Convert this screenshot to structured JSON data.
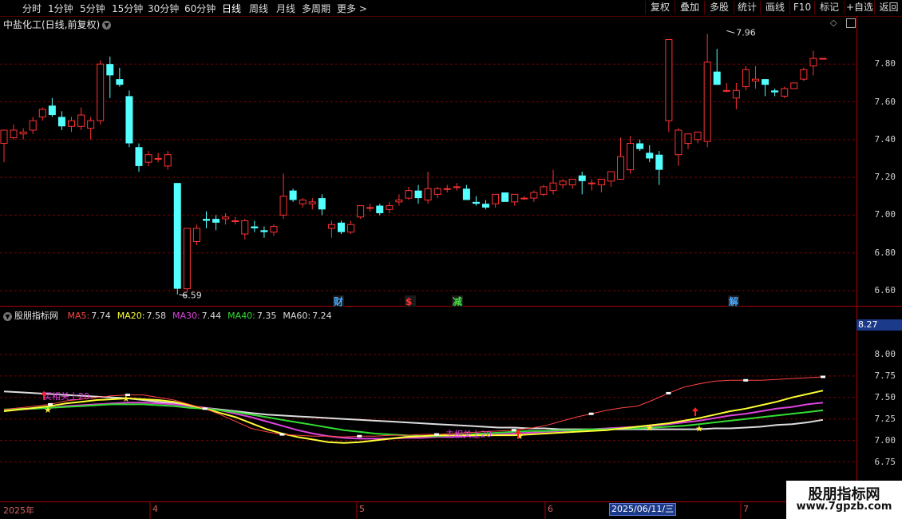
{
  "toolbar": {
    "timeframes": [
      "分时",
      "1分钟",
      "5分钟",
      "15分钟",
      "30分钟",
      "60分钟",
      "日线",
      "周线",
      "月线",
      "多周期",
      "更多 >"
    ],
    "active": "日线",
    "right_buttons": [
      "复权",
      "叠加",
      "多股",
      "统计",
      "画线",
      "F10",
      "标记",
      "+自选",
      "返回"
    ]
  },
  "chart_title": "中盐化工(日线,前复权)",
  "price_panel": {
    "y_ticks": [
      "7.80",
      "7.60",
      "7.40",
      "7.20",
      "7.00",
      "6.80",
      "6.60"
    ],
    "low_label": "6.59",
    "high_label": "7.96",
    "event_tags": [
      {
        "text": "财",
        "color": "#4aa8ff"
      },
      {
        "text": "$",
        "color": "#ff3333"
      },
      {
        "text": "减",
        "color": "#44dd44"
      },
      {
        "text": "解",
        "color": "#4aa8ff"
      }
    ]
  },
  "indicator": {
    "name": "股朋指标网",
    "ma": [
      {
        "label": "MA5:",
        "value": "7.74",
        "color": "#ff4444"
      },
      {
        "label": "MA20:",
        "value": "7.58",
        "color": "#ffff33"
      },
      {
        "label": "MA30:",
        "value": "7.44",
        "color": "#dd44dd"
      },
      {
        "label": "MA40:",
        "value": "7.35",
        "color": "#33dd33"
      },
      {
        "label": "MA60:",
        "value": "7.24",
        "color": "#dddddd"
      }
    ],
    "current_value": "8.27",
    "y_ticks": [
      "8.00",
      "7.75",
      "7.50",
      "7.25",
      "7.00",
      "6.75"
    ],
    "annotations": [
      "买相关上20",
      "主相关上20"
    ]
  },
  "x_axis": {
    "labels": [
      "2025年",
      "4",
      "5",
      "6",
      "7"
    ],
    "cursor_date": "2025/06/11/三"
  },
  "candles": [
    [
      7.38,
      7.45,
      7.28,
      7.45
    ],
    [
      7.41,
      7.48,
      7.4,
      7.45
    ],
    [
      7.43,
      7.46,
      7.4,
      7.44
    ],
    [
      7.45,
      7.52,
      7.43,
      7.5
    ],
    [
      7.52,
      7.57,
      7.5,
      7.56
    ],
    [
      7.58,
      7.62,
      7.52,
      7.53
    ],
    [
      7.52,
      7.55,
      7.45,
      7.47
    ],
    [
      7.47,
      7.52,
      7.44,
      7.5
    ],
    [
      7.47,
      7.57,
      7.45,
      7.53
    ],
    [
      7.46,
      7.52,
      7.4,
      7.5
    ],
    [
      7.5,
      7.82,
      7.48,
      7.8
    ],
    [
      7.8,
      7.84,
      7.62,
      7.74
    ],
    [
      7.72,
      7.78,
      7.68,
      7.69
    ],
    [
      7.63,
      7.66,
      7.36,
      7.38
    ],
    [
      7.36,
      7.38,
      7.23,
      7.26
    ],
    [
      7.28,
      7.34,
      7.26,
      7.32
    ],
    [
      7.3,
      7.33,
      7.28,
      7.3
    ],
    [
      7.26,
      7.34,
      7.24,
      7.32
    ],
    [
      7.17,
      7.17,
      6.58,
      6.61
    ],
    [
      6.61,
      6.93,
      6.59,
      6.93
    ],
    [
      6.86,
      6.95,
      6.84,
      6.93
    ],
    [
      6.98,
      7.02,
      6.93,
      6.97
    ],
    [
      6.98,
      7.0,
      6.92,
      6.96
    ],
    [
      6.98,
      7.01,
      6.95,
      6.99
    ],
    [
      6.97,
      6.99,
      6.95,
      6.97
    ],
    [
      6.9,
      6.98,
      6.87,
      6.97
    ],
    [
      6.94,
      6.97,
      6.91,
      6.93
    ],
    [
      6.92,
      6.94,
      6.88,
      6.91
    ],
    [
      6.91,
      6.95,
      6.89,
      6.94
    ],
    [
      7.0,
      7.22,
      6.98,
      7.1
    ],
    [
      7.13,
      7.14,
      7.07,
      7.08
    ],
    [
      7.06,
      7.09,
      7.04,
      7.08
    ],
    [
      7.06,
      7.09,
      7.03,
      7.07
    ],
    [
      7.09,
      7.11,
      7.0,
      7.03
    ],
    [
      6.93,
      6.97,
      6.88,
      6.95
    ],
    [
      6.96,
      6.97,
      6.9,
      6.91
    ],
    [
      6.91,
      6.97,
      6.9,
      6.95
    ],
    [
      6.99,
      7.05,
      6.98,
      7.05
    ],
    [
      7.04,
      7.06,
      7.02,
      7.04
    ],
    [
      7.05,
      7.06,
      7.0,
      7.01
    ],
    [
      7.03,
      7.07,
      7.01,
      7.05
    ],
    [
      7.07,
      7.11,
      7.05,
      7.08
    ],
    [
      7.09,
      7.15,
      7.08,
      7.13
    ],
    [
      7.13,
      7.16,
      7.06,
      7.09
    ],
    [
      7.08,
      7.23,
      7.06,
      7.14
    ],
    [
      7.11,
      7.15,
      7.09,
      7.14
    ],
    [
      7.14,
      7.16,
      7.12,
      7.14
    ],
    [
      7.15,
      7.17,
      7.13,
      7.15
    ],
    [
      7.14,
      7.16,
      7.09,
      7.08
    ],
    [
      7.07,
      7.1,
      7.05,
      7.06
    ],
    [
      7.06,
      7.08,
      7.03,
      7.04
    ],
    [
      7.06,
      7.09,
      7.04,
      7.11
    ],
    [
      7.12,
      7.12,
      7.08,
      7.07
    ],
    [
      7.07,
      7.11,
      7.05,
      7.11
    ],
    [
      7.09,
      7.1,
      7.08,
      7.09
    ],
    [
      7.09,
      7.13,
      7.07,
      7.12
    ],
    [
      7.11,
      7.16,
      7.1,
      7.15
    ],
    [
      7.13,
      7.24,
      7.11,
      7.17
    ],
    [
      7.16,
      7.19,
      7.14,
      7.18
    ],
    [
      7.16,
      7.19,
      7.14,
      7.19
    ],
    [
      7.21,
      7.23,
      7.11,
      7.18
    ],
    [
      7.17,
      7.19,
      7.13,
      7.17
    ],
    [
      7.16,
      7.19,
      7.12,
      7.19
    ],
    [
      7.18,
      7.2,
      7.15,
      7.23
    ],
    [
      7.19,
      7.41,
      7.19,
      7.31
    ],
    [
      7.24,
      7.42,
      7.22,
      7.38
    ],
    [
      7.38,
      7.4,
      7.34,
      7.35
    ],
    [
      7.33,
      7.37,
      7.28,
      7.3
    ],
    [
      7.32,
      7.34,
      7.16,
      7.24
    ],
    [
      7.5,
      7.93,
      7.44,
      7.93
    ],
    [
      7.32,
      7.46,
      7.26,
      7.45
    ],
    [
      7.38,
      7.43,
      7.35,
      7.43
    ],
    [
      7.4,
      7.44,
      7.38,
      7.44
    ],
    [
      7.39,
      7.96,
      7.36,
      7.81
    ],
    [
      7.76,
      7.88,
      7.69,
      7.69
    ],
    [
      7.66,
      7.7,
      7.65,
      7.66
    ],
    [
      7.62,
      7.7,
      7.56,
      7.66
    ],
    [
      7.68,
      7.79,
      7.66,
      7.77
    ],
    [
      7.71,
      7.79,
      7.67,
      7.72
    ],
    [
      7.72,
      7.72,
      7.63,
      7.69
    ],
    [
      7.66,
      7.67,
      7.63,
      7.65
    ],
    [
      7.63,
      7.68,
      7.62,
      7.67
    ],
    [
      7.67,
      7.7,
      7.67,
      7.7
    ],
    [
      7.72,
      7.78,
      7.71,
      7.77
    ],
    [
      7.79,
      7.87,
      7.74,
      7.83
    ],
    [
      7.83,
      7.83,
      7.83,
      7.83
    ]
  ],
  "ma_series": {
    "MA5": [
      7.36,
      7.38,
      7.4,
      7.42,
      7.46,
      7.48,
      7.5,
      7.52,
      7.53,
      7.53,
      7.5,
      7.47,
      7.42,
      7.37,
      7.3,
      7.22,
      7.14,
      7.1,
      7.07,
      7.06,
      7.05,
      7.05,
      7.04,
      7.05,
      7.05,
      7.06,
      7.06,
      7.07,
      7.07,
      7.08,
      7.09,
      7.1,
      7.11,
      7.12,
      7.14,
      7.17,
      7.22,
      7.27,
      7.31,
      7.35,
      7.38,
      7.4,
      7.47,
      7.55,
      7.62,
      7.66,
      7.69,
      7.7,
      7.7,
      7.7,
      7.71,
      7.72,
      7.73,
      7.74
    ],
    "MA20": [
      7.34,
      7.36,
      7.38,
      7.4,
      7.43,
      7.45,
      7.47,
      7.48,
      7.49,
      7.48,
      7.47,
      7.45,
      7.41,
      7.37,
      7.32,
      7.27,
      7.2,
      7.13,
      7.08,
      7.04,
      7.01,
      6.98,
      6.97,
      6.98,
      7.0,
      7.02,
      7.04,
      7.05,
      7.06,
      7.06,
      7.06,
      7.06,
      7.06,
      7.06,
      7.07,
      7.08,
      7.09,
      7.1,
      7.11,
      7.12,
      7.14,
      7.16,
      7.18,
      7.2,
      7.23,
      7.26,
      7.3,
      7.34,
      7.37,
      7.41,
      7.45,
      7.5,
      7.54,
      7.58
    ],
    "MA30": [
      7.35,
      7.36,
      7.37,
      7.38,
      7.4,
      7.41,
      7.42,
      7.43,
      7.44,
      7.44,
      7.43,
      7.42,
      7.4,
      7.38,
      7.35,
      7.31,
      7.27,
      7.22,
      7.17,
      7.12,
      7.08,
      7.05,
      7.03,
      7.02,
      7.02,
      7.02,
      7.03,
      7.03,
      7.04,
      7.04,
      7.05,
      7.06,
      7.07,
      7.08,
      7.09,
      7.1,
      7.11,
      7.12,
      7.13,
      7.14,
      7.15,
      7.16,
      7.17,
      7.19,
      7.21,
      7.23,
      7.26,
      7.29,
      7.31,
      7.34,
      7.37,
      7.39,
      7.42,
      7.44
    ],
    "MA40": [
      7.36,
      7.37,
      7.37,
      7.38,
      7.39,
      7.4,
      7.41,
      7.42,
      7.42,
      7.42,
      7.41,
      7.4,
      7.38,
      7.37,
      7.35,
      7.33,
      7.3,
      7.27,
      7.24,
      7.21,
      7.18,
      7.15,
      7.12,
      7.1,
      7.08,
      7.07,
      7.06,
      7.05,
      7.05,
      7.06,
      7.07,
      7.08,
      7.09,
      7.1,
      7.11,
      7.11,
      7.12,
      7.12,
      7.13,
      7.13,
      7.14,
      7.14,
      7.15,
      7.16,
      7.17,
      7.19,
      7.21,
      7.23,
      7.25,
      7.27,
      7.29,
      7.31,
      7.33,
      7.35
    ],
    "MA60": [
      7.57,
      7.56,
      7.55,
      7.54,
      7.53,
      7.52,
      7.51,
      7.5,
      7.49,
      7.47,
      7.45,
      7.43,
      7.4,
      7.38,
      7.36,
      7.34,
      7.32,
      7.3,
      7.29,
      7.28,
      7.27,
      7.26,
      7.25,
      7.24,
      7.23,
      7.22,
      7.21,
      7.2,
      7.19,
      7.18,
      7.17,
      7.16,
      7.15,
      7.15,
      7.14,
      7.14,
      7.13,
      7.13,
      7.13,
      7.13,
      7.13,
      7.13,
      7.13,
      7.13,
      7.13,
      7.13,
      7.14,
      7.14,
      7.15,
      7.16,
      7.18,
      7.19,
      7.21,
      7.24
    ]
  }
}
